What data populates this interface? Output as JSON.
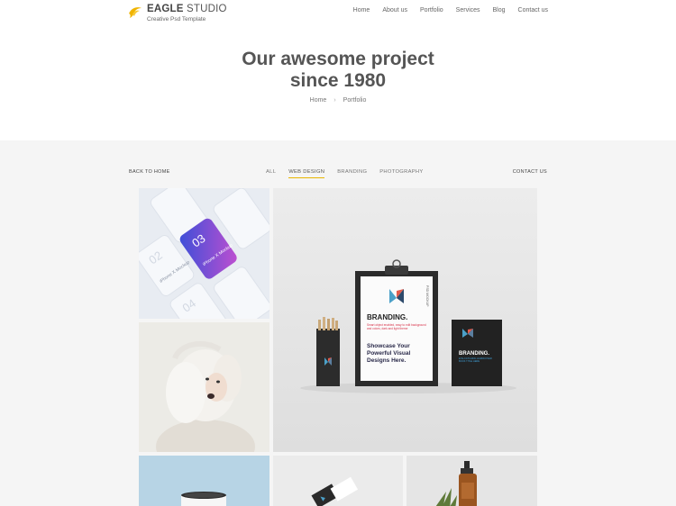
{
  "header": {
    "logo_name_bold": "EAGLE",
    "logo_name_rest": " STUDIO",
    "logo_tagline": "Creative Psd Template",
    "nav": [
      "Home",
      "About us",
      "Portfolio",
      "Services",
      "Blog",
      "Contact us"
    ]
  },
  "hero": {
    "title_line1": "Our awesome project",
    "title_line2": "since 1980",
    "breadcrumb": [
      "Home",
      "Portfolio"
    ]
  },
  "gallery": {
    "back_link": "BACK TO HOME",
    "contact_link": "CONTACT US",
    "filters": [
      "ALL",
      "WEB DESIGN",
      "BRANDING",
      "PHOTOGRAPHY"
    ],
    "active_filter": "WEB DESIGN",
    "mockup": {
      "brand_heading": "BRANDING.",
      "red_text": "Smart object enabled, easy to edit background and colors, dark and light theme",
      "tagline_1": "Showcase Your",
      "tagline_2": "Powerful Visual",
      "tagline_3": "Designs Here.",
      "side_label": "PSD MOCKUP",
      "box_heading": "BRANDING.",
      "box_sub": "EYE-CATCHING HARDCOVER BOOK TITLE HERE"
    },
    "phones": {
      "label_1": "iPhone X Mockup",
      "label_2": "iPhone X Mockup",
      "num_1": "02",
      "num_2": "03",
      "num_3": "04"
    }
  },
  "colors": {
    "accent": "#e8b400",
    "gallery_bg": "#f5f5f5",
    "text_dark": "#555555"
  }
}
